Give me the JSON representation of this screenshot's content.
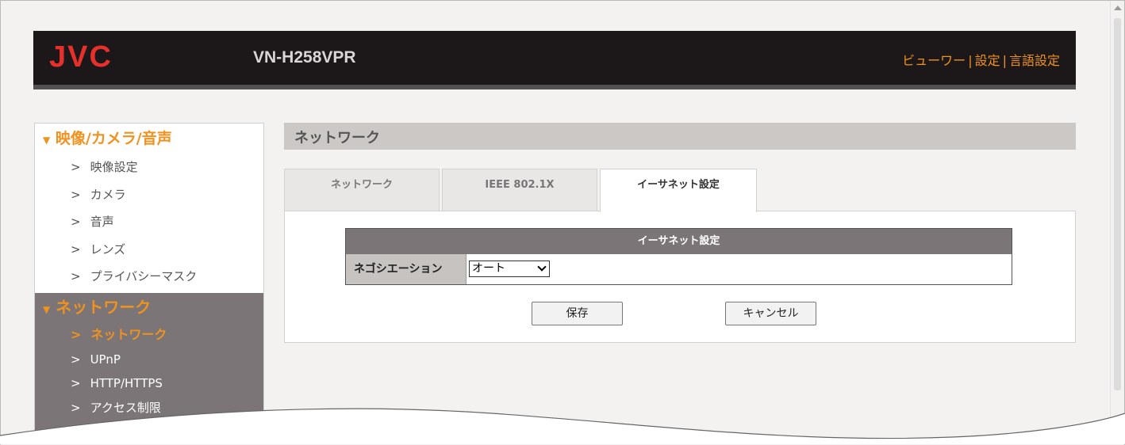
{
  "header": {
    "logo": "JVC",
    "model": "VN-H258VPR",
    "links": [
      "ビューワー",
      "設定",
      "言語設定"
    ]
  },
  "sidebar": {
    "section1": {
      "title": "映像/カメラ/音声",
      "items": [
        "映像設定",
        "カメラ",
        "音声",
        "レンズ",
        "プライバシーマスク"
      ]
    },
    "section2": {
      "title": "ネットワーク",
      "items": [
        "ネットワーク",
        "UPnP",
        "HTTP/HTTPS",
        "アクセス制限"
      ],
      "active_index": 0
    },
    "arrow": ">",
    "toggle": "▼"
  },
  "main": {
    "title": "ネットワーク",
    "tabs": [
      "ネットワーク",
      "IEEE 802.1X",
      "イーサネット設定"
    ],
    "active_tab": 2,
    "table_title": "イーサネット設定",
    "field_label": "ネゴシエーション",
    "field_value": "オート",
    "save_label": "保存",
    "cancel_label": "キャンセル"
  },
  "colors": {
    "accent": "#f0921e",
    "logo": "#e6302c",
    "header_bg": "#1c1718"
  }
}
